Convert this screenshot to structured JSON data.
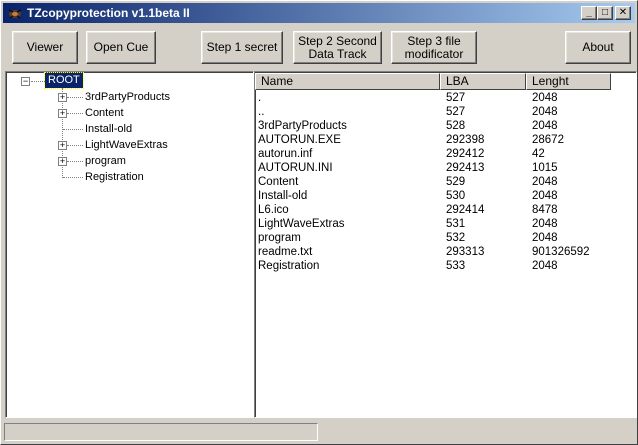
{
  "window": {
    "title": "TZcopyprotection v1.1beta II",
    "controls": {
      "minimize": "_",
      "maximize": "□",
      "close": "✕"
    }
  },
  "toolbar": {
    "viewer": "Viewer",
    "open_cue": "Open Cue",
    "step1": "Step 1 secret",
    "step2_line1": "Step 2 Second",
    "step2_line2": "Data Track",
    "step3_line1": "Step 3 file",
    "step3_line2": "modificator",
    "about": "About"
  },
  "tree": {
    "root": "ROOT",
    "items": [
      {
        "label": "3rdPartyProducts",
        "expandable": true
      },
      {
        "label": "Content",
        "expandable": true
      },
      {
        "label": "Install-old",
        "expandable": false
      },
      {
        "label": "LightWaveExtras",
        "expandable": true
      },
      {
        "label": "program",
        "expandable": true
      },
      {
        "label": "Registration",
        "expandable": false
      }
    ]
  },
  "files": {
    "columns": [
      "Name",
      "LBA",
      "Lenght"
    ],
    "rows": [
      [
        ".",
        "527",
        "2048"
      ],
      [
        "..",
        "527",
        "2048"
      ],
      [
        "3rdPartyProducts",
        "528",
        "2048"
      ],
      [
        "AUTORUN.EXE",
        "292398",
        "28672"
      ],
      [
        "autorun.inf",
        "292412",
        "42"
      ],
      [
        "AUTORUN.INI",
        "292413",
        "1015"
      ],
      [
        "Content",
        "529",
        "2048"
      ],
      [
        "Install-old",
        "530",
        "2048"
      ],
      [
        "L6.ico",
        "292414",
        "8478"
      ],
      [
        "LightWaveExtras",
        "531",
        "2048"
      ],
      [
        "program",
        "532",
        "2048"
      ],
      [
        "readme.txt",
        "293313",
        "901326592"
      ],
      [
        "Registration",
        "533",
        "2048"
      ]
    ]
  },
  "status": {
    "text": ""
  },
  "colors": {
    "title_start": "#0a246a",
    "title_end": "#a6caf0",
    "face": "#d4d0c8",
    "selection": "#0a246a"
  }
}
